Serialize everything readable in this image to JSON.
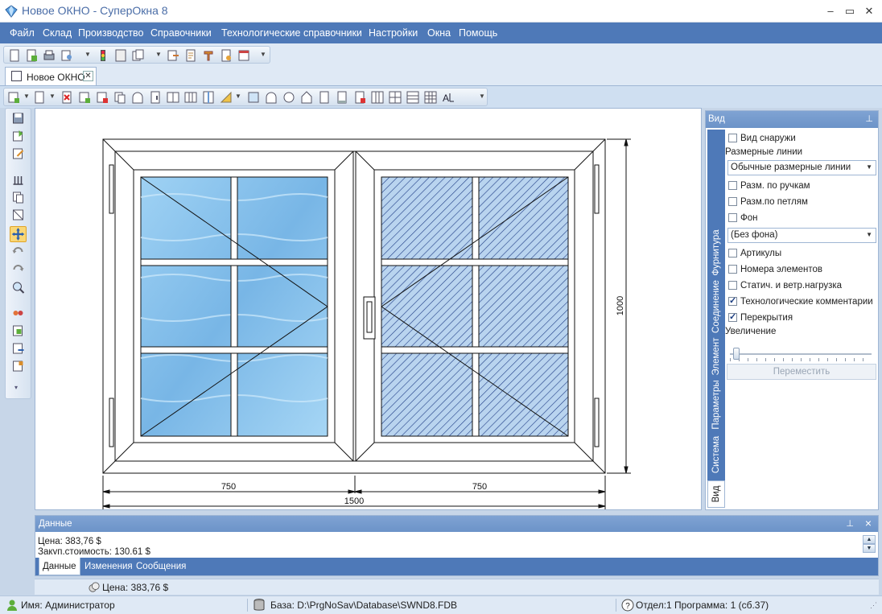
{
  "window": {
    "title": "Новое ОКНО - СуперОкна 8",
    "minimize": "–",
    "maximize": "▭",
    "close": "✕"
  },
  "menu": [
    "Файл",
    "Склад",
    "Производство",
    "Справочники",
    "Технологические справочники",
    "Настройки",
    "Окна",
    "Помощь"
  ],
  "doc_tab": {
    "label": "Новое ОКНО",
    "close": "✕"
  },
  "drawing": {
    "dim_left": "750",
    "dim_right": "750",
    "dim_total": "1500",
    "dim_height": "1000"
  },
  "side_panel": {
    "title": "Вид",
    "pin": "📌",
    "tabs": [
      "Вид",
      "Система",
      "Параметры",
      "Элемент",
      "Соединение",
      "Фурнитура"
    ],
    "view_outside": {
      "label": "Вид снаружи",
      "checked": false
    },
    "dim_lines_label": "Размерные линии",
    "dim_lines_value": "Обычные размерные линии",
    "dim_by_handles": {
      "label": "Разм. по ручкам",
      "checked": false
    },
    "dim_by_hinges": {
      "label": "Разм.по петлям",
      "checked": false
    },
    "background": {
      "label": "Фон",
      "checked": false
    },
    "background_value": "(Без фона)",
    "articles": {
      "label": "Артикулы",
      "checked": false
    },
    "element_numbers": {
      "label": "Номера элементов",
      "checked": false
    },
    "static_wind_load": {
      "label": "Статич. и ветр.нагрузка",
      "checked": false
    },
    "tech_comments": {
      "label": "Технологические комментарии",
      "checked": true
    },
    "overlaps": {
      "label": "Перекрытия",
      "checked": true
    },
    "zoom_label": "Увеличение",
    "move_button": "Переместить"
  },
  "data_panel": {
    "title": "Данные",
    "lines": [
      "Цена: 383,76 $",
      "Закуп.стоимость: 130,61 $"
    ],
    "tabs": [
      "Данные",
      "Изменения",
      "Сообщения"
    ]
  },
  "status": {
    "price": "Цена: 383,76 $",
    "user": "Имя: Администратор",
    "database": "База: D:\\PrgNoSav\\Database\\SWND8.FDB",
    "department": "Отдел:1 Программа: 1 (сб.37)"
  },
  "colors": {
    "menubar": "#4e79b8",
    "accent": "#6c93c8",
    "glass_left": "#8cc6ee",
    "glass_right": "#9fc8ea"
  }
}
